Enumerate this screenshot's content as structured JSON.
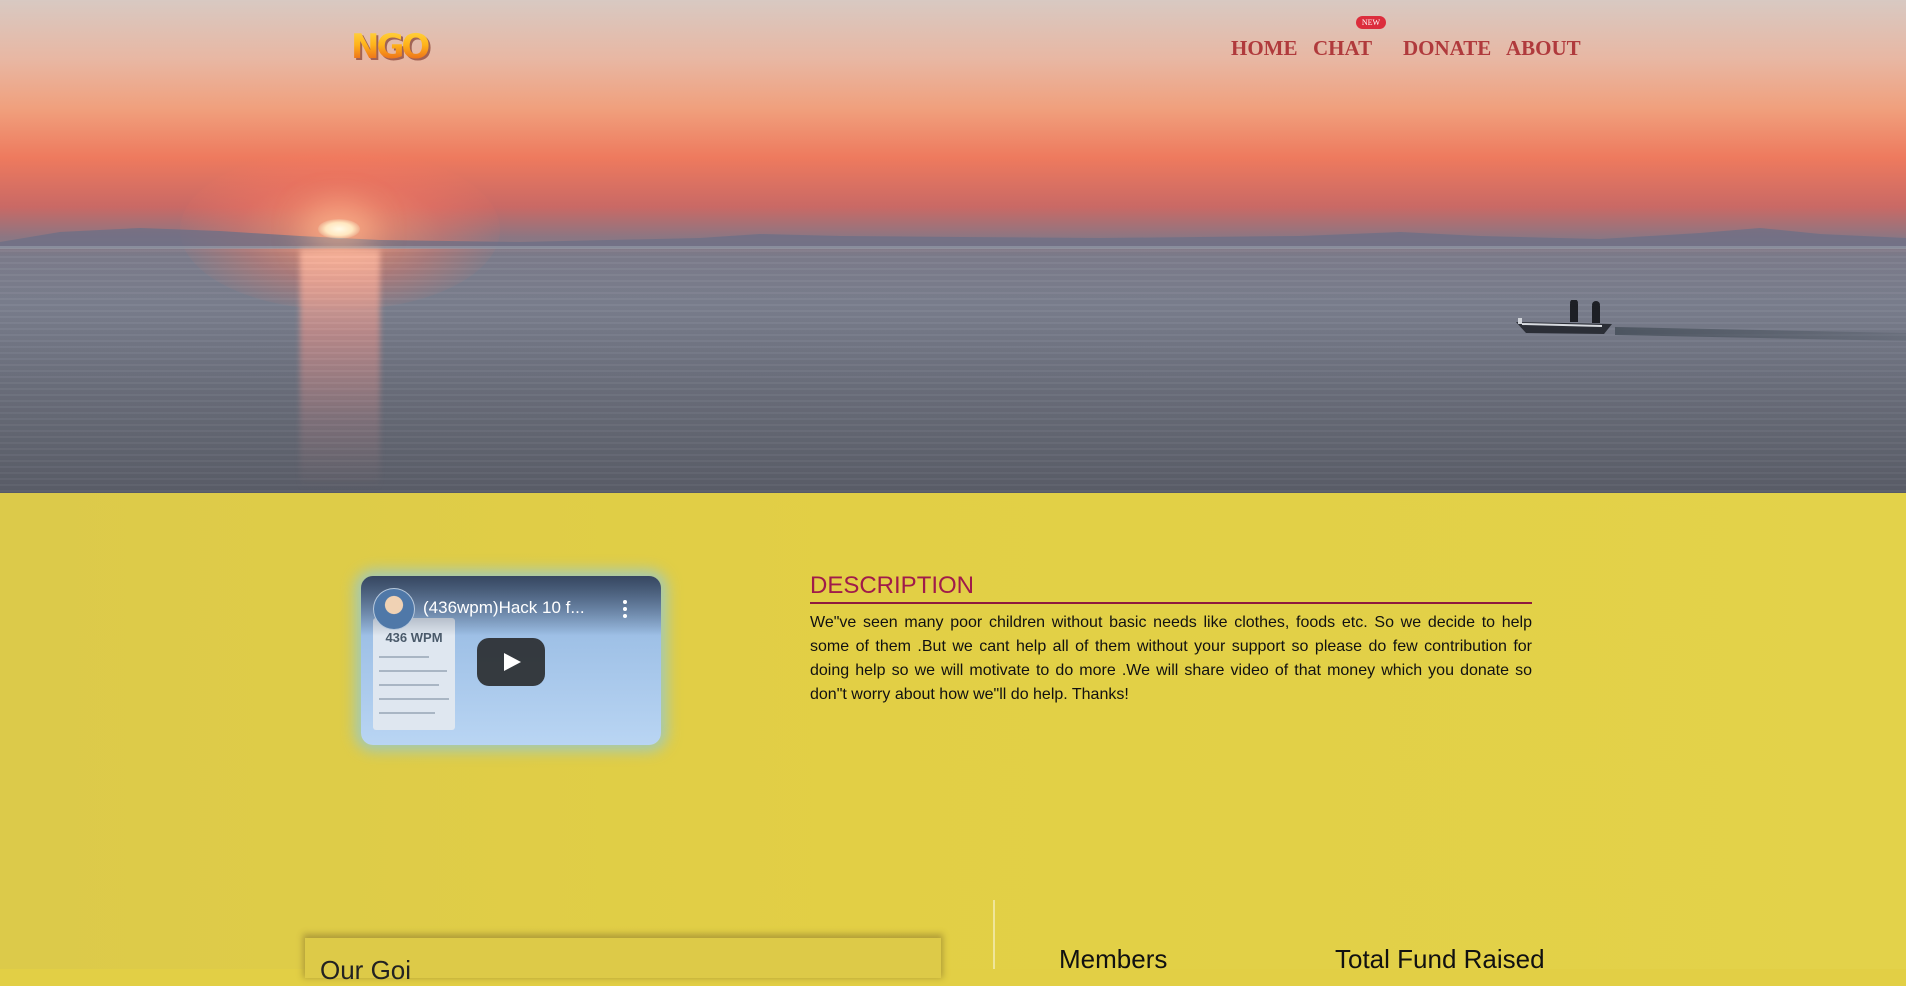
{
  "brand": {
    "logo_text": "NGO"
  },
  "nav": {
    "items": [
      {
        "label": "HOME"
      },
      {
        "label": "CHAT"
      },
      {
        "label": "DONATE"
      },
      {
        "label": "ABOUT"
      }
    ],
    "chat_badge": "NEW"
  },
  "video": {
    "title": "(436wpm)Hack 10 f...",
    "thumbnail_text": "436 WPM"
  },
  "description": {
    "heading": "DESCRIPTION",
    "text": "We\"ve seen many poor children without basic needs like clothes, foods etc. So we decide to help some of them .But we cant help all of them without your support so please do few contribution for doing help so we will motivate to do more .We will share video of that money which you donate so don\"t worry about how we\"ll do help. Thanks!"
  },
  "stats": {
    "panel_title": "Our Goi",
    "members_label": "Members",
    "funds_label": "Total Fund Raised"
  },
  "colors": {
    "nav_text": "#b03a3c",
    "badge": "#dc2d3c",
    "heading": "#a01b4a",
    "content_bg": "#e2cf45"
  }
}
